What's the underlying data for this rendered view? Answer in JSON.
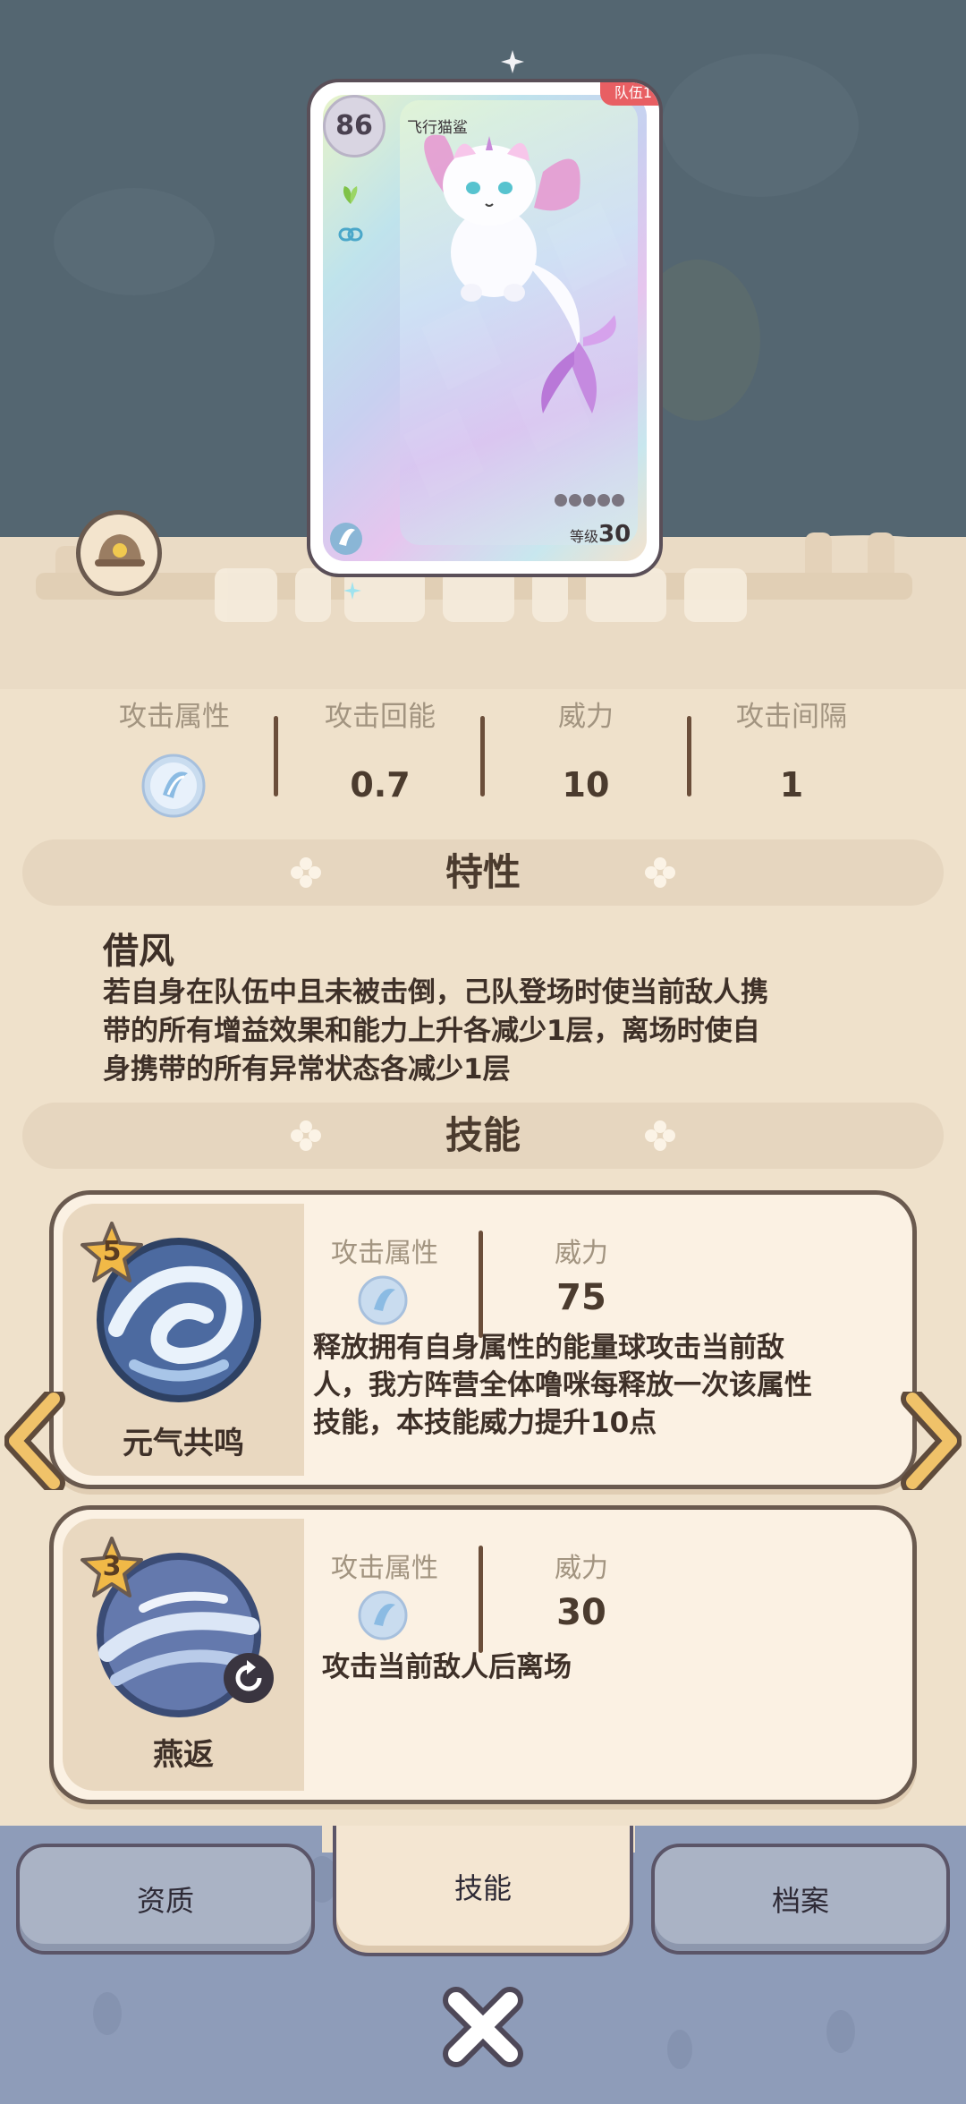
{
  "card": {
    "score": "86",
    "name": "飞行猫鲨",
    "team_badge": "队伍1",
    "level_label": "等级",
    "level_value": "30"
  },
  "stats": [
    {
      "label": "攻击属性",
      "value": "",
      "icon": "wind-element-icon"
    },
    {
      "label": "攻击回能",
      "value": "0.7"
    },
    {
      "label": "威力",
      "value": "10"
    },
    {
      "label": "攻击间隔",
      "value": "1"
    }
  ],
  "trait": {
    "section_title": "特性",
    "name": "借风",
    "desc_line1": "若自身在队伍中且未被击倒，己队登场时使当前敌人携",
    "desc_line2": "带的所有增益效果和能力上升各减少1层，离场时使自",
    "desc_line3": "身携带的所有异常状态各减少1层"
  },
  "skills_section_title": "技能",
  "skills": [
    {
      "cost": "5",
      "name": "元气共鸣",
      "attr_label": "攻击属性",
      "power_label": "威力",
      "power": "75",
      "desc_line1": "释放拥有自身属性的能量球攻击当前敌",
      "desc_line2": "人，我方阵营全体噜咪每释放一次该属性",
      "desc_line3": "技能，本技能威力提升10点"
    },
    {
      "cost": "3",
      "name": "燕返",
      "attr_label": "攻击属性",
      "power_label": "威力",
      "power": "30",
      "desc_line1": "攻击当前敌人后离场"
    }
  ],
  "tabs": [
    {
      "label": "资质"
    },
    {
      "label": "技能",
      "active": true
    },
    {
      "label": "档案"
    }
  ],
  "colors": {
    "sky": "#546671",
    "sand": "#efe1cb",
    "text_dark": "#4b3b2e",
    "label": "#a29480",
    "nav": "#8e9cb9",
    "badge": "#e85f63"
  }
}
